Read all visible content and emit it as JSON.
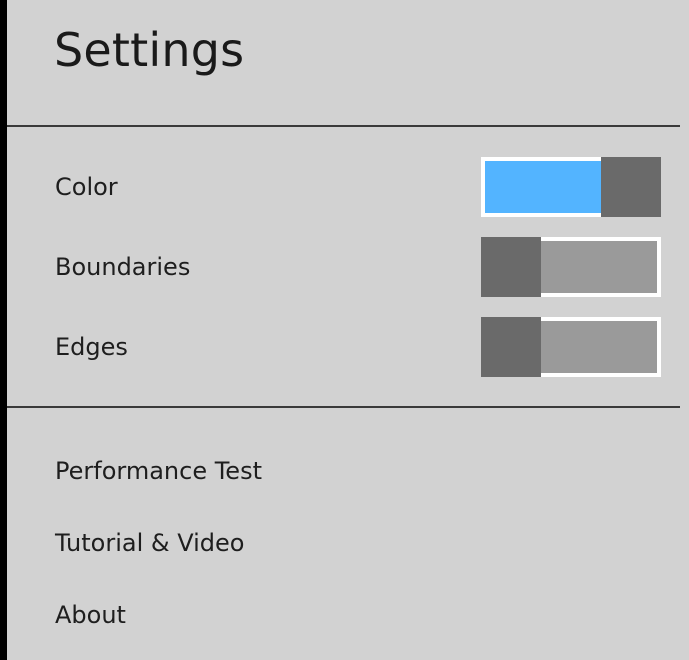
{
  "header": {
    "title": "Settings"
  },
  "settings": [
    {
      "label": "Color",
      "state": "on"
    },
    {
      "label": "Boundaries",
      "state": "off"
    },
    {
      "label": "Edges",
      "state": "off"
    }
  ],
  "links": [
    {
      "label": "Performance Test"
    },
    {
      "label": "Tutorial & Video"
    },
    {
      "label": "About"
    }
  ],
  "colors": {
    "panel_background": "#d2d2d2",
    "toggle_on_fill": "#53b4ff",
    "toggle_off_fill": "#9a9a9a",
    "toggle_thumb": "#6a6a6a",
    "toggle_border": "#ffffff",
    "divider": "#3a3a3a",
    "text": "#1e1e1e"
  }
}
